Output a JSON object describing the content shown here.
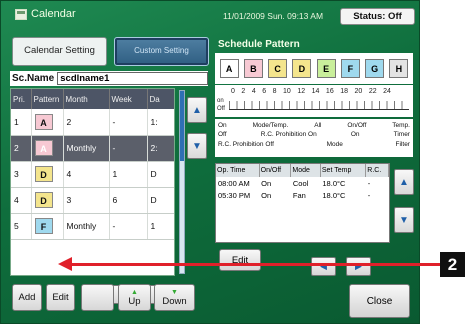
{
  "app": {
    "title": "Calendar",
    "datetime": "11/01/2009 Sun. 09:13 AM",
    "status_label": "Status: Off"
  },
  "tabs": {
    "calendar_setting": "Calendar Setting",
    "custom_setting": "Custom Setting"
  },
  "scname": {
    "label": "Sc.Name",
    "value": "scdlname1"
  },
  "schedule_table": {
    "headers": [
      "Pri.",
      "Pattern",
      "Month",
      "Week",
      "Da"
    ],
    "rows": [
      {
        "pri": "1",
        "pattern": "A",
        "month": "2",
        "week": "-",
        "day": "1:"
      },
      {
        "pri": "2",
        "pattern": "A",
        "month": "Monthly",
        "week": "-",
        "day": "2:"
      },
      {
        "pri": "3",
        "pattern": "D",
        "month": "4",
        "week": "1",
        "day": "D"
      },
      {
        "pri": "4",
        "pattern": "D",
        "month": "3",
        "week": "6",
        "day": "D"
      },
      {
        "pri": "5",
        "pattern": "F",
        "month": "Monthly",
        "week": "-",
        "day": "1"
      }
    ]
  },
  "left_buttons": {
    "add": "Add",
    "edit": "Edit",
    "up": "Up",
    "down": "Down"
  },
  "right": {
    "title": "Schedule Pattern",
    "patterns": [
      "A",
      "B",
      "C",
      "D",
      "E",
      "F",
      "G",
      "H"
    ],
    "hours": [
      "0",
      "2",
      "4",
      "6",
      "8",
      "10",
      "12",
      "14",
      "16",
      "18",
      "20",
      "22",
      "24"
    ],
    "timeline_labels": {
      "on": "on",
      "off": "Off"
    },
    "legend": {
      "row1": [
        "On",
        "Mode/Temp.",
        "All",
        "On/Off",
        "Temp."
      ],
      "row2": [
        "Off",
        "R.C. Prohibition On",
        "On",
        "Timer"
      ],
      "row3": [
        "R.C. Prohibition Off",
        "Mode",
        "Filter"
      ]
    },
    "op_table": {
      "headers": [
        "Op. Time",
        "On/Off",
        "Mode",
        "Set Temp",
        "R.C."
      ],
      "rows": [
        {
          "time": "08:00 AM",
          "onoff": "On",
          "mode": "Cool",
          "temp": "18.0°C",
          "rc": "-"
        },
        {
          "time": "05:30 PM",
          "onoff": "On",
          "mode": "Fan",
          "temp": "18.0°C",
          "rc": "-"
        }
      ]
    },
    "edit": "Edit",
    "close": "Close"
  },
  "callout": {
    "number": "2"
  },
  "colors": {
    "pattern_a": "#f7c9d3",
    "pattern_d": "#f4e58d",
    "pattern_f": "#9fd9ee",
    "callout": "#e0202a"
  },
  "icons": [
    "calendar-icon",
    "up-arrow-icon",
    "down-arrow-icon",
    "left-arrow-icon",
    "right-arrow-icon"
  ]
}
